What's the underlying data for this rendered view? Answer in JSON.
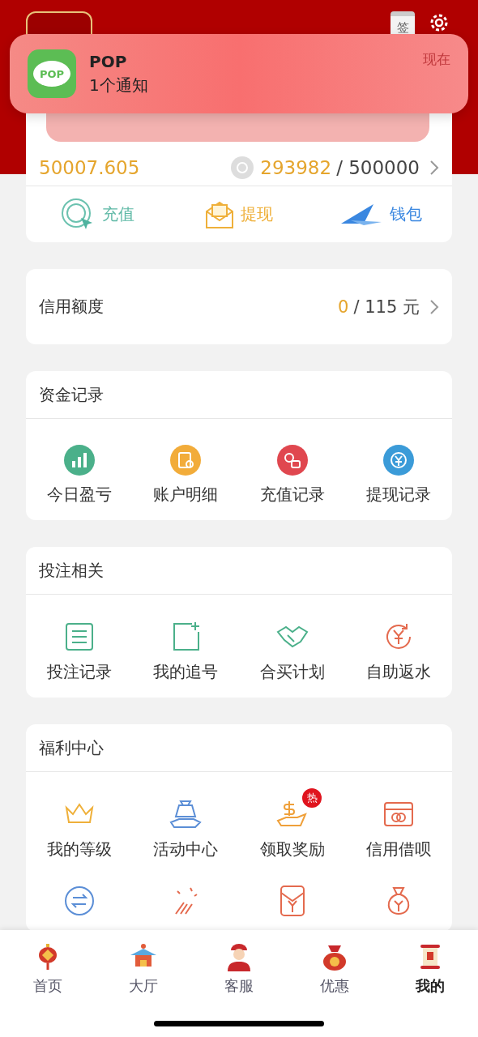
{
  "header": {
    "checkin_badge": "签"
  },
  "notification": {
    "app": "POP",
    "icon_text": "POP",
    "message": "1个通知",
    "time": "现在"
  },
  "balance": {
    "amount": "50007.605",
    "points": "293982",
    "points_limit": "/ 500000",
    "actions": [
      {
        "label": "充值",
        "kind": "deposit"
      },
      {
        "label": "提现",
        "kind": "withdraw"
      },
      {
        "label": "钱包",
        "kind": "wallet"
      }
    ]
  },
  "credit": {
    "label": "信用额度",
    "used": "0",
    "total": "/ 115 元"
  },
  "sections": [
    {
      "title": "资金记录",
      "items": [
        {
          "label": "今日盈亏",
          "kind": "chart"
        },
        {
          "label": "账户明细",
          "kind": "ledger"
        },
        {
          "label": "充值记录",
          "kind": "coins"
        },
        {
          "label": "提现记录",
          "kind": "yen"
        }
      ]
    },
    {
      "title": "投注相关",
      "items": [
        {
          "label": "投注记录",
          "kind": "list"
        },
        {
          "label": "我的追号",
          "kind": "addbox"
        },
        {
          "label": "合买计划",
          "kind": "handshake"
        },
        {
          "label": "自助返水",
          "kind": "refund"
        }
      ]
    },
    {
      "title": "福利中心",
      "items": [
        {
          "label": "我的等级",
          "kind": "crown"
        },
        {
          "label": "活动中心",
          "kind": "gift"
        },
        {
          "label": "领取奖励",
          "kind": "reward",
          "badge": "热"
        },
        {
          "label": "信用借呗",
          "kind": "card"
        },
        {
          "kind": "exchange"
        },
        {
          "kind": "firework"
        },
        {
          "kind": "envelope"
        },
        {
          "kind": "moneybag"
        }
      ]
    }
  ],
  "tabs": [
    {
      "label": "首页",
      "kind": "lantern",
      "selected": false
    },
    {
      "label": "大厅",
      "kind": "pavilion",
      "selected": false
    },
    {
      "label": "客服",
      "kind": "agent",
      "selected": false
    },
    {
      "label": "优惠",
      "kind": "bag",
      "selected": false
    },
    {
      "label": "我的",
      "kind": "scroll",
      "selected": true
    }
  ]
}
